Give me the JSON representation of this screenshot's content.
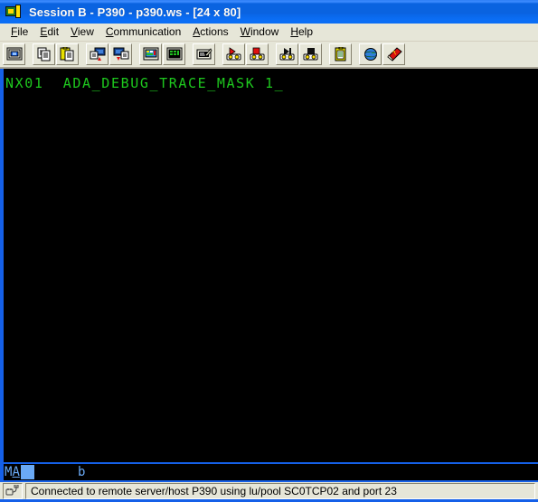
{
  "window": {
    "title": "Session B - P390 - p390.ws - [24 x 80]",
    "icon": "terminal-session-icon"
  },
  "menubar": [
    {
      "label": "File",
      "accel": "F",
      "rest": "ile"
    },
    {
      "label": "Edit",
      "accel": "E",
      "rest": "dit"
    },
    {
      "label": "View",
      "accel": "V",
      "rest": "iew"
    },
    {
      "label": "Communication",
      "accel": "C",
      "rest": "ommunication"
    },
    {
      "label": "Actions",
      "accel": "A",
      "rest": "ctions"
    },
    {
      "label": "Window",
      "accel": "W",
      "rest": "indow"
    },
    {
      "label": "Help",
      "accel": "H",
      "rest": "elp"
    }
  ],
  "toolbar": {
    "buttons": [
      {
        "name": "display-session-icon",
        "tooltip": "Display session"
      },
      {
        "name": "copy-icon",
        "tooltip": "Copy"
      },
      {
        "name": "paste-icon",
        "tooltip": "Paste"
      },
      {
        "name": "send-file-icon",
        "tooltip": "Send file to host"
      },
      {
        "name": "receive-file-icon",
        "tooltip": "Receive file from host"
      },
      {
        "name": "display-setup-icon",
        "tooltip": "Display setup"
      },
      {
        "name": "keypad-icon",
        "tooltip": "Keypad"
      },
      {
        "name": "edit-screen-icon",
        "tooltip": "Edit screen"
      },
      {
        "name": "record-macro-icon",
        "tooltip": "Record macro"
      },
      {
        "name": "stop-recording-icon",
        "tooltip": "Stop recording macro"
      },
      {
        "name": "play-macro-icon",
        "tooltip": "Play macro"
      },
      {
        "name": "stop-playing-icon",
        "tooltip": "Stop playing macro"
      },
      {
        "name": "clipboard-icon",
        "tooltip": "Clipboard"
      },
      {
        "name": "globe-icon",
        "tooltip": "Internet"
      },
      {
        "name": "help-book-icon",
        "tooltip": "Help"
      }
    ]
  },
  "terminal": {
    "rows": 24,
    "cols": 80,
    "foreground_color": "#1ec81e",
    "background_color": "#000000",
    "lines": [
      "NX01  ADA_DEBUG_TRACE_MASK 1"
    ],
    "cursor_glyph": "_"
  },
  "oia": {
    "indicator": "MA",
    "indicator_underlined_char": "A",
    "shift_block": "",
    "field_indicator": "b",
    "color": "#6aa9f5"
  },
  "statusbar": {
    "icon": "connection-plug-icon",
    "message": "Connected to remote server/host P390 using lu/pool SC0TCP02 and port 23"
  },
  "colors": {
    "title_bar": "#0a63e0",
    "window_face": "#e6e6d8",
    "terminal_border": "#1560e8",
    "terminal_green": "#1ec81e",
    "oia_blue": "#6aa9f5"
  }
}
